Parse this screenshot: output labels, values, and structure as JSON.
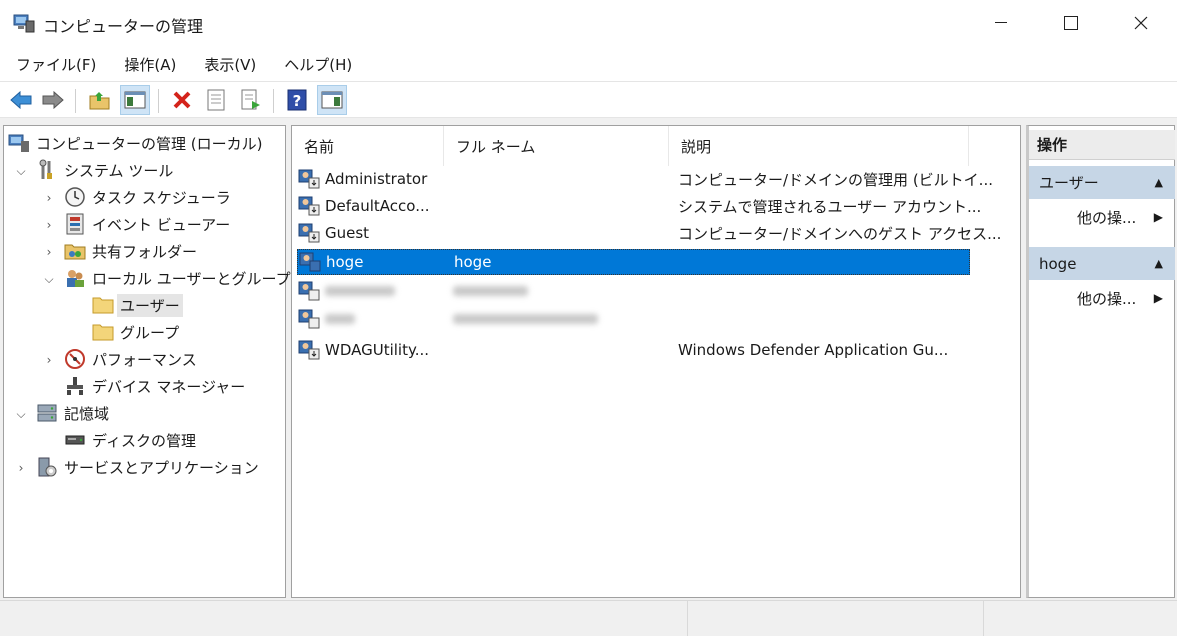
{
  "window": {
    "title": "コンピューターの管理"
  },
  "menu": [
    "ファイル(F)",
    "操作(A)",
    "表示(V)",
    "ヘルプ(H)"
  ],
  "toolbar": {
    "icons": [
      "back-arrow-icon",
      "forward-arrow-icon",
      "up-folder-icon",
      "show-hide-tree-icon",
      "delete-icon",
      "properties-icon",
      "export-list-icon",
      "help-icon",
      "show-hide-action-pane-icon"
    ]
  },
  "tree": {
    "items": [
      {
        "label": "コンピューターの管理 (ローカル)"
      },
      {
        "label": "システム ツール"
      },
      {
        "label": "タスク スケジューラ"
      },
      {
        "label": "イベント ビューアー"
      },
      {
        "label": "共有フォルダー"
      },
      {
        "label": "ローカル ユーザーとグループ"
      },
      {
        "label": "ユーザー"
      },
      {
        "label": "グループ"
      },
      {
        "label": "パフォーマンス"
      },
      {
        "label": "デバイス マネージャー"
      },
      {
        "label": "記憶域"
      },
      {
        "label": "ディスクの管理"
      },
      {
        "label": "サービスとアプリケーション"
      }
    ]
  },
  "list": {
    "columns": [
      "名前",
      "フル ネーム",
      "説明"
    ],
    "rows": [
      {
        "name": "Administrator",
        "full_name": "",
        "description": "コンピューター/ドメインの管理用 (ビルトイ..."
      },
      {
        "name": "DefaultAcco...",
        "full_name": "",
        "description": "システムで管理されるユーザー アカウント..."
      },
      {
        "name": "Guest",
        "full_name": "",
        "description": "コンピューター/ドメインへのゲスト アクセス..."
      },
      {
        "name": "hoge",
        "full_name": "hoge",
        "description": ""
      },
      {
        "name": "",
        "full_name": "",
        "description": ""
      },
      {
        "name": "",
        "full_name": "",
        "description": ""
      },
      {
        "name": "WDAGUtility...",
        "full_name": "",
        "description": "Windows Defender Application Gu..."
      }
    ]
  },
  "actions": {
    "title": "操作",
    "groups": [
      {
        "label": "ユーザー",
        "item": "他の操..."
      },
      {
        "label": "hoge",
        "item": "他の操..."
      }
    ]
  },
  "colors": {
    "selection": "#0078d7",
    "action_group": "#c6d6e6"
  }
}
